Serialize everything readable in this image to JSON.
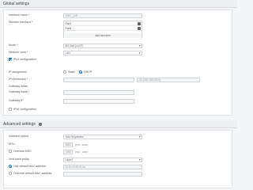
{
  "global": {
    "title": "Global settings",
    "interface_name_label": "Interface name *",
    "interface_name_value": "VNIC_LAN",
    "member_interface_label": "Member interface *",
    "members": [
      "Port2",
      "Port3"
    ],
    "add_new_item": "Add new item",
    "mode_label": "Mode *",
    "mode_value": "802.3ad (LACP)",
    "network_zone_label": "Network zone *",
    "network_zone_value": "LAN",
    "ipv4_config_label": "IPv4 configuration",
    "ip_assignment_label": "IP assignment",
    "ip_static": "Static",
    "ip_dhcp": "DHCP",
    "ipv4_netmask_label": "IPv4/netmask *",
    "netmask_placeholder": "/24 (255.255.255.0)",
    "gateway_detail_label": "Gateway detail",
    "gateway_name_label": "Gateway name *",
    "gateway_ip_label": "Gateway IP",
    "ipv6_config_label": "IPv6 configuration"
  },
  "advanced": {
    "title": "Advanced settings",
    "interface_speed_label": "Interface speed",
    "interface_speed_value": "Auto Negotiation",
    "mtu_label": "MTU",
    "mtu_value": "1500",
    "mtu_hint": "(576 - 9000)",
    "override_mss_label": "Override MSS",
    "mss_value": "1460",
    "mss_hint": "(536 - 1460)",
    "xmit_hash_label": "Xmit hash policy",
    "xmit_hash_value": "Layer2",
    "use_default_mac_label": "Use default MAC address",
    "default_mac_value": "00:0c:29:53:41:0a",
    "override_mac_label": "Override default MAC address"
  },
  "colors": {
    "accent": "#1f7ae0"
  }
}
